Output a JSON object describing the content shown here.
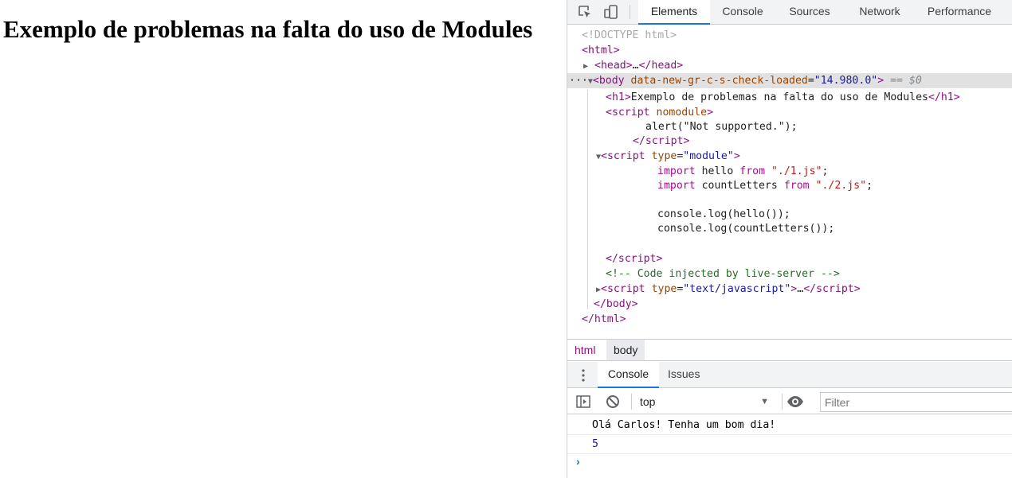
{
  "page": {
    "h1": "Exemplo de problemas na falta do uso de Modules"
  },
  "devtools": {
    "tabs": [
      "Elements",
      "Console",
      "Sources",
      "Network",
      "Performance"
    ],
    "active_tab": "Elements",
    "tree": {
      "doctype": "<!DOCTYPE html>",
      "html_open": "html",
      "head_label": "head",
      "head_ellipsis": "…",
      "body_tag": "body",
      "body_attr": "data-new-gr-c-s-check-loaded",
      "body_attr_value": "\"14.980.0\"",
      "body_suffix": " == $0",
      "h1_tag": "h1",
      "h1_text": "Exemplo de problemas na falta do uso de Modules",
      "script1_tag": "script",
      "script1_attr": "nomodule",
      "script1_body": "alert(\"Not supported.\");",
      "script2_attr": "type",
      "script2_attr_value": "\"module\"",
      "import1": {
        "kw": "import",
        "name": "hello",
        "from": "from",
        "path": "\"./1.js\"",
        "end": ";"
      },
      "import2": {
        "kw": "import",
        "name": "countLetters",
        "from": "from",
        "path": "\"./2.js\"",
        "end": ";"
      },
      "log1": "console.log(hello());",
      "log2": "console.log(countLetters());",
      "comment": "<!-- Code injected by live-server -->",
      "script3_attr": "type",
      "script3_attr_value": "\"text/javascript\"",
      "script3_ellipsis": "…",
      "script_close": "script",
      "body_close": "body",
      "html_close": "html"
    },
    "breadcrumbs": [
      "html",
      "body"
    ],
    "drawer": {
      "tabs": [
        "Console",
        "Issues"
      ],
      "active_tab": "Console",
      "context": "top",
      "filter_placeholder": "Filter",
      "messages": [
        "Olá Carlos! Tenha um bom dia!",
        "5"
      ]
    },
    "colors": {
      "accent": "#1a73e8",
      "tag": "#881280",
      "attr_name": "#994500",
      "attr_value": "#1a1aa6",
      "comment": "#236e25"
    }
  }
}
